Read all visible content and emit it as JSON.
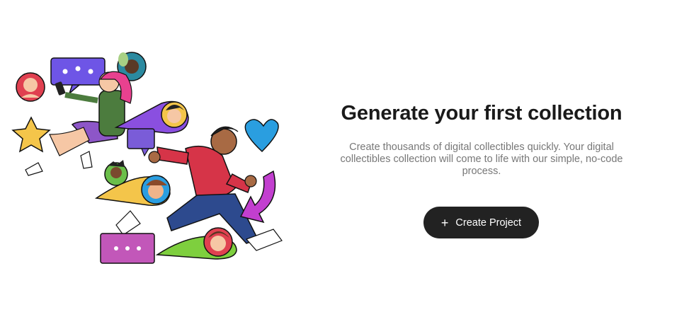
{
  "empty_state": {
    "title": "Generate your first collection",
    "description": "Create thousands of digital collectibles quickly. Your digital collectibles collection will come to life with our simple, no-code process.",
    "cta_label": "Create Project",
    "cta_icon": "+"
  },
  "colors": {
    "title": "#1a1a1a",
    "description": "#777777",
    "button_bg": "#222222",
    "button_text": "#ffffff"
  }
}
